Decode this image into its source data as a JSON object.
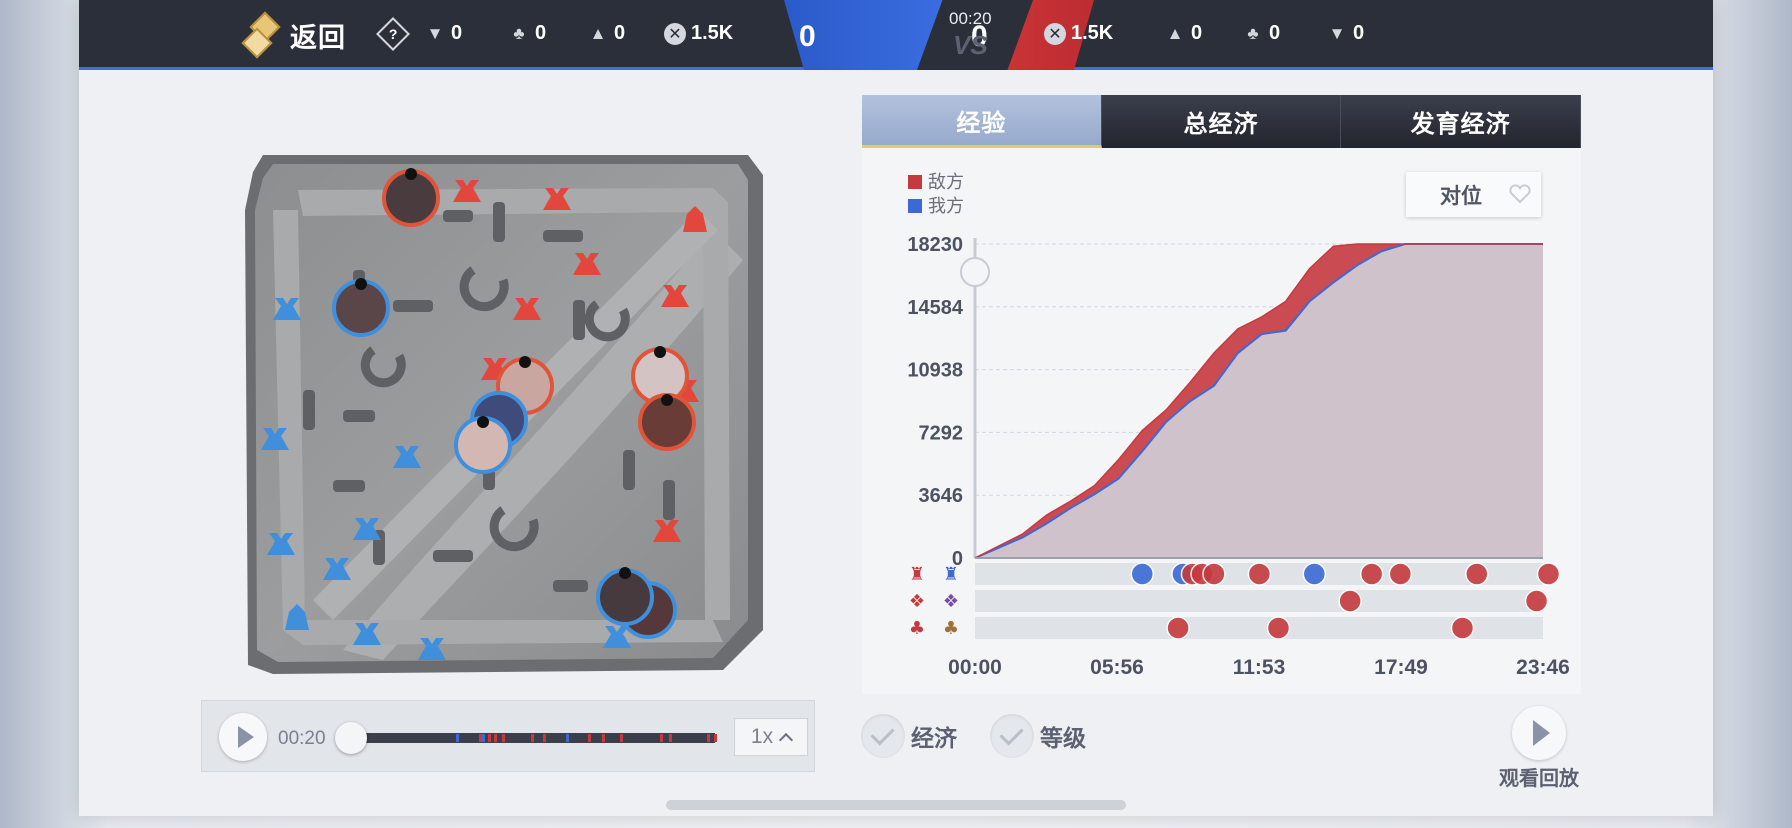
{
  "header": {
    "back_label": "返回",
    "help_glyph": "?",
    "blue_team": {
      "towers": "0",
      "dragons": "0",
      "inhibitors": "0",
      "gold": "1.5K"
    },
    "red_team": {
      "gold": "1.5K",
      "inhibitors": "0",
      "dragons": "0",
      "towers": "0"
    },
    "blue_score": "0",
    "red_score": "0",
    "game_time": "00:20",
    "vs_label": "VS"
  },
  "tabs": [
    {
      "label": "经验",
      "active": true
    },
    {
      "label": "总经济",
      "active": false
    },
    {
      "label": "发育经济",
      "active": false
    }
  ],
  "legend": {
    "enemy": "敌方",
    "ally": "我方"
  },
  "oppose_button": "对位",
  "colors": {
    "enemy": "#c53a3f",
    "ally": "#3b6ad6",
    "area_fill": "#cfc2ca"
  },
  "chart_data": {
    "type": "area",
    "title": "",
    "xlabel": "",
    "ylabel": "",
    "y_ticks": [
      "0",
      "3646",
      "7292",
      "10938",
      "14584",
      "18230"
    ],
    "x_ticks": [
      "00:00",
      "05:56",
      "11:53",
      "17:49",
      "23:46"
    ],
    "ylim": [
      0,
      18230
    ],
    "x_minutes": [
      0,
      1,
      2,
      3,
      4,
      5,
      6,
      7,
      8,
      9,
      10,
      11,
      12,
      13,
      14,
      15,
      16,
      17,
      18,
      19,
      20,
      21,
      22,
      23,
      23.77
    ],
    "series": [
      {
        "name": "敌方",
        "values": [
          0,
          700,
          1400,
          2500,
          3300,
          4200,
          5700,
          7400,
          8600,
          10200,
          11900,
          13300,
          14000,
          14900,
          16800,
          18100,
          18230,
          18230,
          18230,
          18230,
          18230,
          18230,
          18230,
          18230,
          18230
        ]
      },
      {
        "name": "我方",
        "values": [
          0,
          600,
          1200,
          2000,
          2900,
          3700,
          4600,
          6200,
          7900,
          9100,
          10000,
          11900,
          13000,
          13200,
          14900,
          16000,
          17000,
          17800,
          18230,
          18230,
          18230,
          18230,
          18230,
          18230,
          18230
        ]
      }
    ],
    "grid": true
  },
  "events": {
    "tower_row": [
      {
        "t": 7.0,
        "team": "ally"
      },
      {
        "t": 8.7,
        "team": "ally"
      },
      {
        "t": 9.1,
        "team": "enemy"
      },
      {
        "t": 9.5,
        "team": "enemy"
      },
      {
        "t": 10.0,
        "team": "enemy"
      },
      {
        "t": 11.9,
        "team": "enemy"
      },
      {
        "t": 14.2,
        "team": "ally"
      },
      {
        "t": 16.6,
        "team": "enemy"
      },
      {
        "t": 17.8,
        "team": "enemy"
      },
      {
        "t": 21.0,
        "team": "enemy"
      },
      {
        "t": 24.0,
        "team": "enemy"
      }
    ],
    "dragon_row": [
      {
        "t": 15.7,
        "team": "enemy"
      },
      {
        "t": 23.5,
        "team": "enemy"
      }
    ],
    "baron_row": [
      {
        "t": 8.5,
        "team": "enemy"
      },
      {
        "t": 12.7,
        "team": "enemy"
      },
      {
        "t": 20.4,
        "team": "enemy"
      }
    ]
  },
  "player": {
    "current_time": "00:20",
    "progress": 0.0,
    "speed": "1x"
  },
  "toggles": {
    "economy": "经济",
    "level": "等级"
  },
  "watch_replay": "观看回放"
}
